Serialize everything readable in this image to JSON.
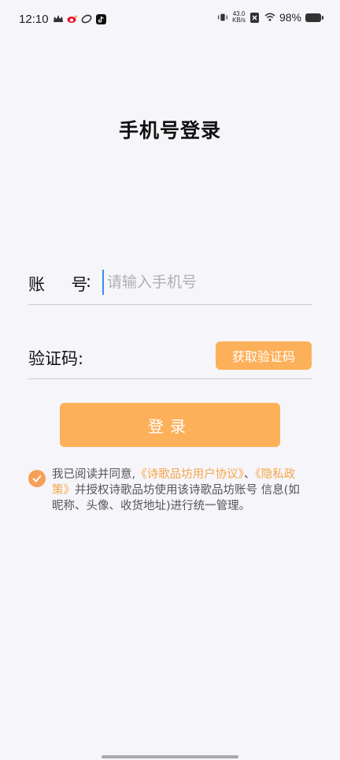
{
  "status_bar": {
    "time": "12:10",
    "net_speed_top": "43.0",
    "net_speed_bottom": "KB/s",
    "battery": "98%",
    "left_icons": [
      "crown-icon",
      "weibo-icon",
      "link-icon",
      "tiktok-icon"
    ],
    "right_icons": [
      "vibrate-icon",
      "sim-x-icon",
      "wifi-icon",
      "battery-icon"
    ]
  },
  "page": {
    "title": "手机号登录"
  },
  "account": {
    "label": "账",
    "label2": "号",
    "colon": ":",
    "placeholder": "请输入手机号",
    "value": ""
  },
  "code": {
    "label": "验证码:",
    "button": "获取验证码"
  },
  "login": {
    "button": "登录"
  },
  "agreement": {
    "checked": true,
    "text_1": "我已阅读并同意,",
    "link_1": "《诗歌品坊用户协议》",
    "text_2": "、",
    "link_2": "《隐私政策》",
    "text_3": "并授权诗歌品坊使用该诗歌品坊账号 信息(如昵称、头像、收货地址)进行统一管理。"
  },
  "colors": {
    "accent": "#fdb05a",
    "check": "#f79f57",
    "link": "#f5a547",
    "background": "#f6f5fa"
  }
}
